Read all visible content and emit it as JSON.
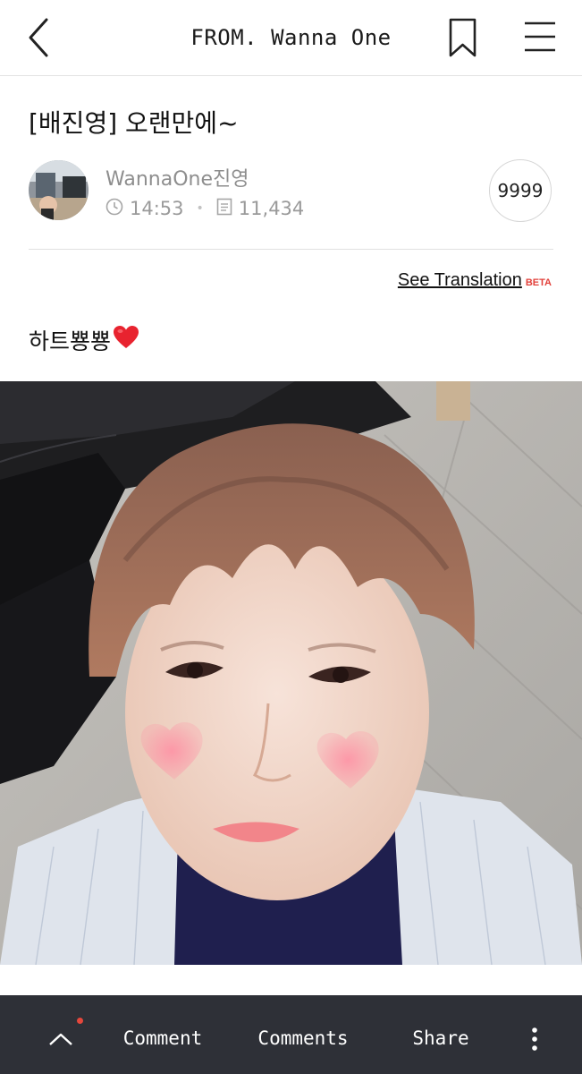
{
  "header": {
    "title": "FROM. Wanna One",
    "back_icon": "chevron-left-icon",
    "bookmark_icon": "bookmark-icon",
    "menu_icon": "hamburger-menu-icon"
  },
  "post": {
    "title": "[배진영] 오랜만에~",
    "author": "WannaOne진영",
    "time": "14:53",
    "views": "11,434",
    "likes": "9999",
    "see_translation": "See Translation",
    "beta": "BETA",
    "body_text": "하트뿅뿅"
  },
  "bottom_bar": {
    "comment": "Comment",
    "comments": "Comments",
    "share": "Share",
    "up_icon": "chevron-up-icon",
    "more_icon": "more-vertical-icon"
  },
  "colors": {
    "accent_red": "#e2403a",
    "bottom_bar_bg": "#2e3037"
  }
}
